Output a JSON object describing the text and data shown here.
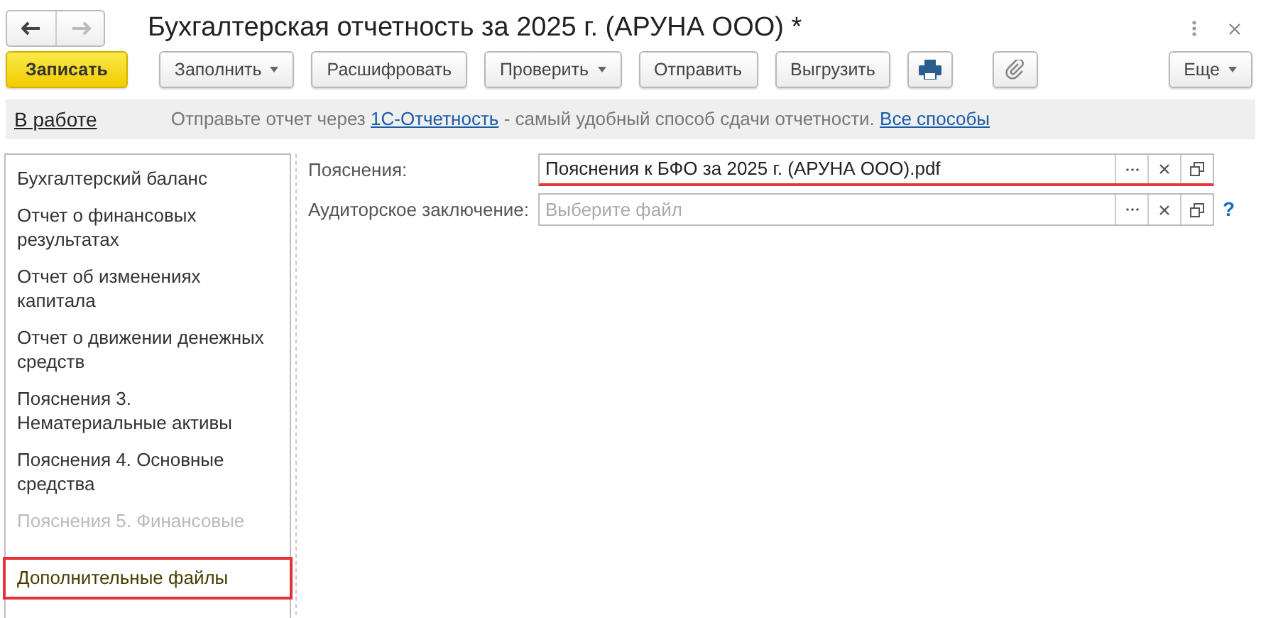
{
  "window": {
    "title": "Бухгалтерская отчетность за 2025 г. (АРУНА ООО) *"
  },
  "nav": [
    {
      "kind": "back",
      "disabled": false
    },
    {
      "kind": "forward",
      "disabled": true
    }
  ],
  "toolbar": [
    {
      "kind": "primary",
      "label": "Записать",
      "dropdown": false
    },
    {
      "kind": "text",
      "label": "Заполнить",
      "dropdown": true
    },
    {
      "kind": "text",
      "label": "Расшифровать",
      "dropdown": false
    },
    {
      "kind": "text",
      "label": "Проверить",
      "dropdown": true
    },
    {
      "kind": "text",
      "label": "Отправить",
      "dropdown": false
    },
    {
      "kind": "text",
      "label": "Выгрузить",
      "dropdown": false
    },
    {
      "kind": "print"
    },
    {
      "kind": "attach"
    },
    {
      "kind": "more",
      "label": "Еще",
      "dropdown": true
    }
  ],
  "info_bar": {
    "status": "В работе",
    "text_before": "Отправьте отчет через",
    "link": "1С-Отчетность",
    "text_after": "- самый удобный способ сдачи отчетности.",
    "link2": "Все способы"
  },
  "sections": [
    {
      "label": "Бухгалтерский баланс",
      "selected": false,
      "faded": false
    },
    {
      "label": "Отчет о финансовых результатах",
      "selected": false,
      "faded": false
    },
    {
      "label": "Отчет об изменениях капитала",
      "selected": false,
      "faded": false
    },
    {
      "label": "Отчет о движении денежных средств",
      "selected": false,
      "faded": false
    },
    {
      "label": "Пояснения 3. Нематериальные активы",
      "selected": false,
      "faded": false
    },
    {
      "label": "Пояснения 4. Основные средства",
      "selected": false,
      "faded": false
    },
    {
      "label": "Пояснения 5. Финансовые",
      "selected": false,
      "faded": true
    },
    {
      "label": "Дополнительные файлы",
      "selected": true,
      "faded": false
    }
  ],
  "fields": [
    {
      "label": "Пояснения:",
      "value": "Пояснения к БФО за 2025 г. (АРУНА ООО).pdf",
      "highlighted": true
    },
    {
      "label": "Аудиторское заключение:",
      "placeholder": "Выберите файл",
      "highlighted": false,
      "help": "?"
    }
  ]
}
